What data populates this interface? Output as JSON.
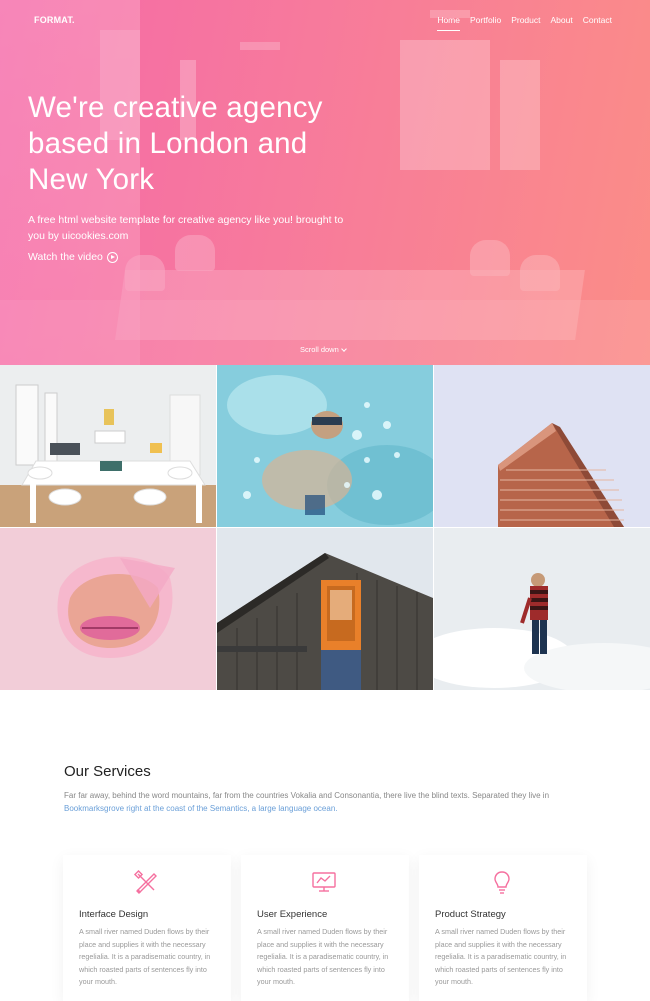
{
  "brand": {
    "logo": "FORMAT.",
    "accent": "#f5709f"
  },
  "nav": {
    "items": [
      "Home",
      "Portfolio",
      "Product",
      "About",
      "Contact"
    ],
    "active": "Home"
  },
  "hero": {
    "title": "We're creative agency based in London and New York",
    "subtitle": "A free html website template for creative agency like you! brought to you by uicookies.com",
    "watch_label": "Watch the video",
    "scroll_label": "Scroll down",
    "gradient": [
      "#f569a8",
      "#fb8d87"
    ]
  },
  "gallery": {
    "items": [
      {
        "subject": "white-office-interior"
      },
      {
        "subject": "swimmer-underwater"
      },
      {
        "subject": "flatiron-building"
      },
      {
        "subject": "lips-through-pink-paper"
      },
      {
        "subject": "wooden-house-orange-window"
      },
      {
        "subject": "man-standing-above-clouds"
      }
    ]
  },
  "services": {
    "title": "Our Services",
    "intro": "Far far away, behind the word mountains, far from the countries Vokalia and Consonantia, there live the blind texts. Separated they live in ",
    "intro_link": "Bookmarksgrove right at the coast of the Semantics, a large language ocean.",
    "cards": [
      {
        "icon": "design-tools-icon",
        "title": "Interface Design",
        "text": "A small river named Duden flows by their place and supplies it with the necessary regelialia. It is a paradisematic country, in which roasted parts of sentences fly into your mouth."
      },
      {
        "icon": "monitor-icon",
        "title": "User Experience",
        "text": "A small river named Duden flows by their place and supplies it with the necessary regelialia. It is a paradisematic country, in which roasted parts of sentences fly into your mouth."
      },
      {
        "icon": "lightbulb-icon",
        "title": "Product Strategy",
        "text": "A small river named Duden flows by their place and supplies it with the necessary regelialia. It is a paradisematic country, in which roasted parts of sentences fly into your mouth."
      }
    ]
  }
}
